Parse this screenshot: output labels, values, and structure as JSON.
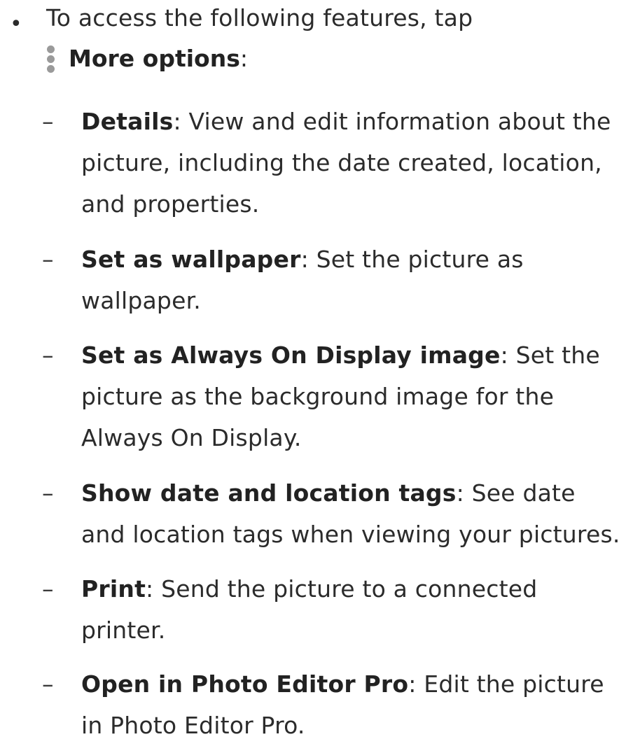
{
  "intro": {
    "bullet": "•",
    "line1": "To access the following features, tap",
    "more_options_label": "More options",
    "colon": ":"
  },
  "icons": {
    "more_options": "kebab-vertical-icon"
  },
  "items": [
    {
      "dash": "–",
      "term": "Details",
      "sep": ":",
      "desc": " View and edit information about the picture, including the date created, location, and properties."
    },
    {
      "dash": "–",
      "term": "Set as wallpaper",
      "sep": ":",
      "desc": " Set the picture as wallpaper."
    },
    {
      "dash": "–",
      "term": "Set as Always On Display image",
      "sep": ":",
      "desc": " Set the picture as the background image for the Always On Display."
    },
    {
      "dash": "–",
      "term": "Show date and location tags",
      "sep": ":",
      "desc": " See date and location tags when viewing your pictures."
    },
    {
      "dash": "–",
      "term": "Print",
      "sep": ":",
      "desc": " Send the picture to a connected printer."
    },
    {
      "dash": "–",
      "term": "Open in Photo Editor Pro",
      "sep": ":",
      "desc": " Edit the picture in Photo Editor Pro."
    }
  ]
}
